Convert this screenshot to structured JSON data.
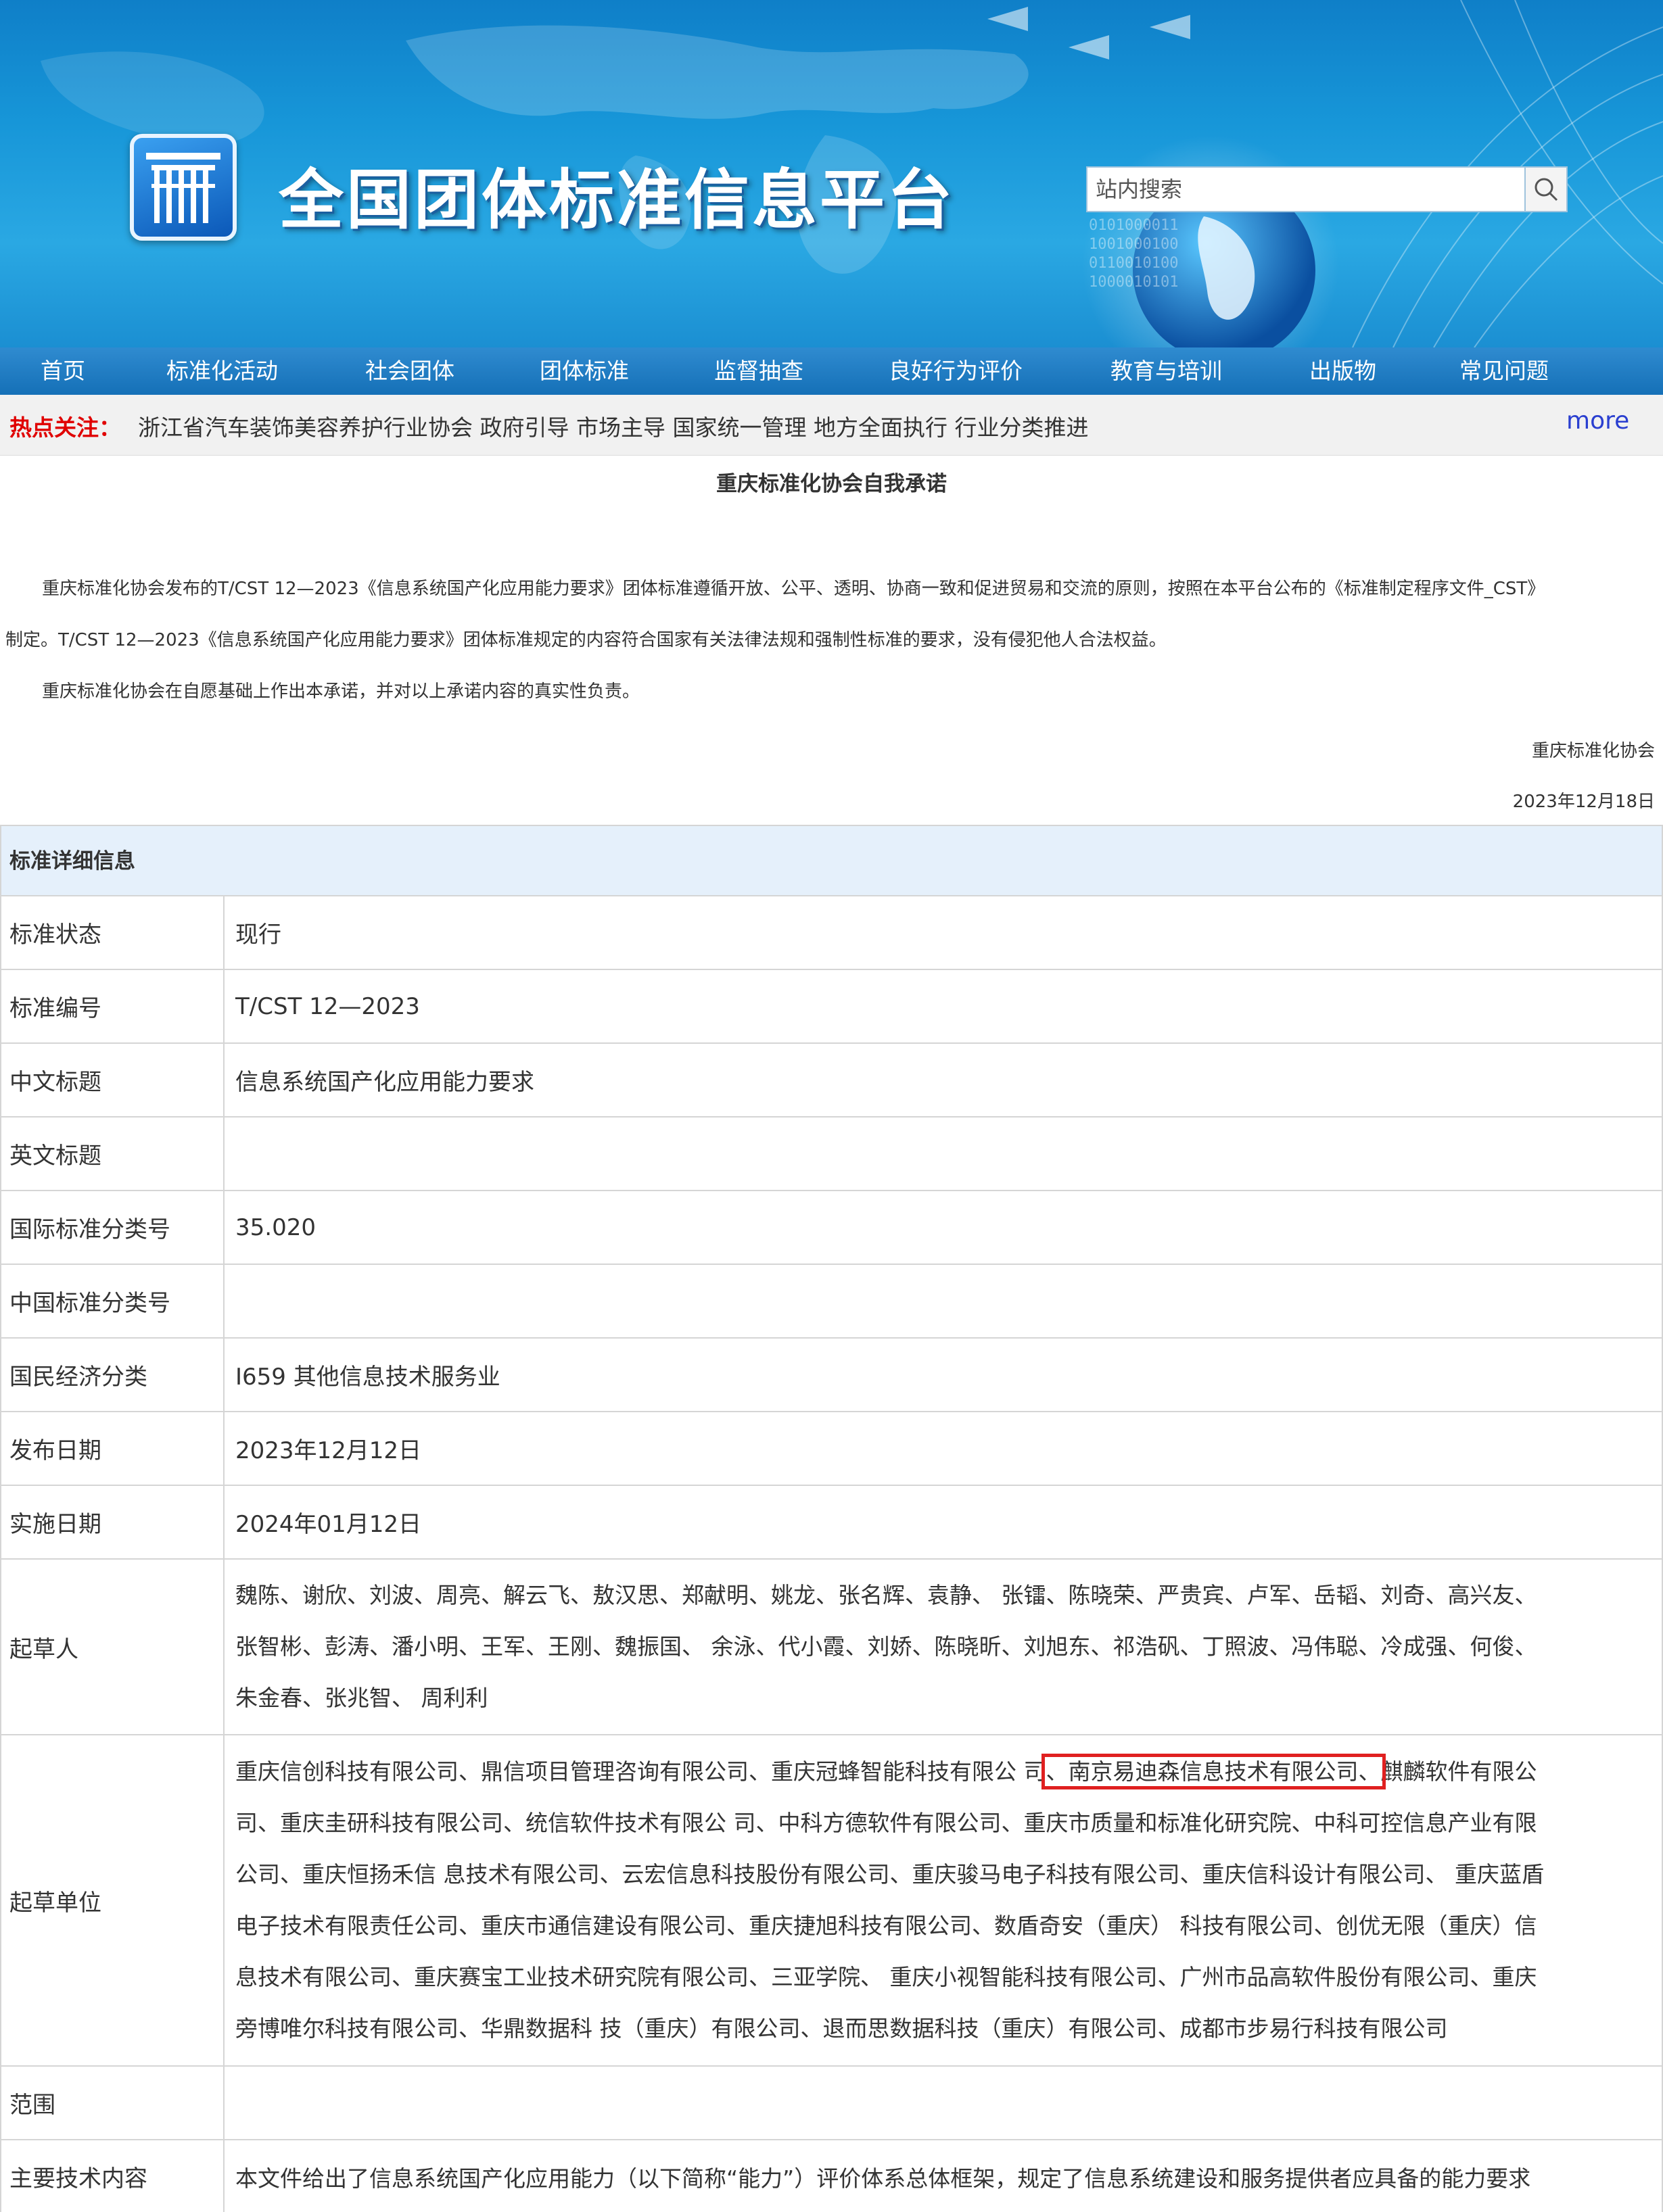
{
  "site": {
    "title": "全国团体标准信息平台",
    "search_placeholder": "站内搜索"
  },
  "nav": {
    "items": [
      "首页",
      "标准化活动",
      "社会团体",
      "团体标准",
      "监督抽查",
      "良好行为评价",
      "教育与培训",
      "出版物",
      "常见问题"
    ]
  },
  "hot": {
    "label": "热点关注：",
    "text": "浙江省汽车装饰美容养护行业协会 政府引导 市场主导 国家统一管理 地方全面执行 行业分类推进",
    "more": "more"
  },
  "notice": {
    "title": "重庆标准化协会自我承诺",
    "line1": "重庆标准化协会发布的T/CST 12—2023《信息系统国产化应用能力要求》团体标准遵循开放、公平、透明、协商一致和促进贸易和交流的原则，按照在本平台公布的《标准制定程序文件_CST》",
    "line2": "制定。T/CST 12—2023《信息系统国产化应用能力要求》团体标准规定的内容符合国家有关法律法规和强制性标准的要求，没有侵犯他人合法权益。",
    "line3": "重庆标准化协会在自愿基础上作出本承诺，并对以上承诺内容的真实性负责。",
    "signer": "重庆标准化协会",
    "date": "2023年12月18日"
  },
  "detail": {
    "heading": "标准详细信息",
    "rows": [
      {
        "label": "标准状态",
        "value": "现行"
      },
      {
        "label": "标准编号",
        "value": "T/CST 12—2023"
      },
      {
        "label": "中文标题",
        "value": "信息系统国产化应用能力要求"
      },
      {
        "label": "英文标题",
        "value": ""
      },
      {
        "label": "国际标准分类号",
        "value": "35.020"
      },
      {
        "label": "中国标准分类号",
        "value": ""
      },
      {
        "label": "国民经济分类",
        "value": "I659 其他信息技术服务业"
      },
      {
        "label": "发布日期",
        "value": "2023年12月12日"
      },
      {
        "label": "实施日期",
        "value": "2024年01月12日"
      }
    ],
    "drafters_label": "起草人",
    "drafters": [
      "魏陈、谢欣、刘波、周亮、解云飞、敖汉思、郑献明、姚龙、张名辉、袁静、 张镭、陈晓荣、严贵宾、卢军、岳韬、刘奇、高兴友、",
      "张智彬、彭涛、潘小明、王军、王刚、魏振国、 余泳、代小霞、刘娇、陈晓昕、刘旭东、祁浩矾、丁照波、冯伟聪、冷成强、何俊、",
      "朱金春、张兆智、 周利利"
    ],
    "units_label": "起草单位",
    "units_line1_pre": "重庆信创科技有限公司、鼎信项目管理咨询有限公司、重庆冠蜂智能科技有限公 司",
    "units_line1_hl": "、南京易迪森信息技术有限公司、",
    "units_line1_post": "麒麟软件有限公",
    "units": [
      "司、重庆圭研科技有限公司、统信软件技术有限公 司、中科方德软件有限公司、重庆市质量和标准化研究院、中科可控信息产业有限",
      "公司、重庆恒扬禾信 息技术有限公司、云宏信息科技股份有限公司、重庆骏马电子科技有限公司、重庆信科设计有限公司、 重庆蓝盾",
      "电子技术有限责任公司、重庆市通信建设有限公司、重庆捷旭科技有限公司、数盾奇安（重庆） 科技有限公司、创优无限（重庆）信",
      "息技术有限公司、重庆赛宝工业技术研究院有限公司、三亚学院、 重庆小视智能科技有限公司、广州市品高软件股份有限公司、重庆",
      "旁博唯尔科技有限公司、华鼎数据科 技（重庆）有限公司、退而思数据科技（重庆）有限公司、成都市步易行科技有限公司"
    ],
    "scope_label": "范围",
    "scope_value": "",
    "content_label": "主要技术内容",
    "content_value": "本文件给出了信息系统国产化应用能力（以下简称“能力”）评价体系总体框架，规定了信息系统建设和服务提供者应具备的能力要求"
  },
  "colors": {
    "nav_bg": "#1f7dc4",
    "hot_label": "#e00000",
    "more_link": "#2a3fd0",
    "detail_head_bg": "#e5f0fb",
    "highlight_box": "#e02020"
  }
}
